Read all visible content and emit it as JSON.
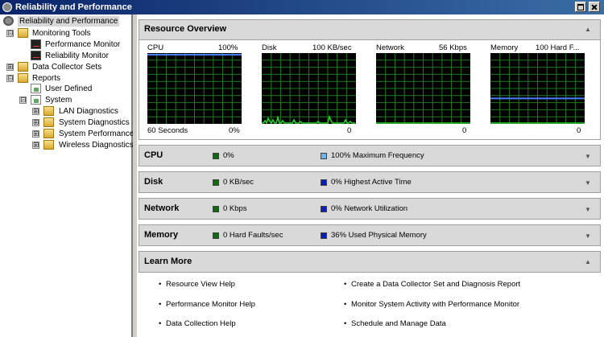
{
  "window": {
    "title": "Reliability and Performance"
  },
  "tree": {
    "items": [
      {
        "label": "Reliability and Performance",
        "icon": "gear-icon"
      },
      {
        "label": "Monitoring Tools",
        "expander": "⊟",
        "icon": "folder-icon"
      },
      {
        "label": "Performance Monitor",
        "icon": "monitor-icon"
      },
      {
        "label": "Reliability Monitor",
        "icon": "monitor-icon"
      },
      {
        "label": "Data Collector Sets",
        "expander": "⊞",
        "icon": "folder-icon"
      },
      {
        "label": "Reports",
        "expander": "⊟",
        "icon": "folder-icon"
      },
      {
        "label": "User Defined",
        "icon": "report-icon"
      },
      {
        "label": "System",
        "expander": "⊟",
        "icon": "report-icon"
      },
      {
        "label": "LAN Diagnostics",
        "expander": "⊞",
        "icon": "folder-icon"
      },
      {
        "label": "System Diagnostics",
        "expander": "⊞",
        "icon": "folder-icon"
      },
      {
        "label": "System Performance",
        "expander": "⊞",
        "icon": "folder-icon"
      },
      {
        "label": "Wireless Diagnostics",
        "expander": "⊞",
        "icon": "folder-icon"
      }
    ]
  },
  "overview": {
    "title": "Resource Overview",
    "collapse_glyph": "▲",
    "graphs": [
      {
        "name": "CPU",
        "max": "100%",
        "bottom_left": "60 Seconds",
        "bottom_right": "0%"
      },
      {
        "name": "Disk",
        "max": "100 KB/sec",
        "bottom_left": "",
        "bottom_right": "0"
      },
      {
        "name": "Network",
        "max": "56 Kbps",
        "bottom_left": "",
        "bottom_right": "0"
      },
      {
        "name": "Memory",
        "max": "100 Hard F...",
        "bottom_left": "",
        "bottom_right": "0"
      }
    ]
  },
  "sections": [
    {
      "title": "CPU",
      "left_text": "0%",
      "right_text": "100% Maximum Frequency",
      "left_color": "#0f6b0f",
      "right_color": "#6fb6e8"
    },
    {
      "title": "Disk",
      "left_text": "0 KB/sec",
      "right_text": "0% Highest Active Time",
      "left_color": "#0f6b0f",
      "right_color": "#0a1fb5"
    },
    {
      "title": "Network",
      "left_text": "0 Kbps",
      "right_text": "0% Network Utilization",
      "left_color": "#0f6b0f",
      "right_color": "#0a1fb5"
    },
    {
      "title": "Memory",
      "left_text": "0 Hard Faults/sec",
      "right_text": "36% Used Physical Memory",
      "left_color": "#0f6b0f",
      "right_color": "#0a1fb5"
    }
  ],
  "expand_glyph": "▼",
  "learn_more": {
    "title": "Learn More",
    "collapse_glyph": "▲",
    "links": [
      "Resource View Help",
      "Performance Monitor Help",
      "Data Collection Help",
      "Create a Data Collector Set and Diagnosis Report",
      "Monitor System Activity with Performance Monitor",
      "Schedule and Manage Data"
    ]
  },
  "colors": {
    "grid": "#1f7a1f",
    "series_blue": "#4a7cff",
    "series_green": "#2bd62b"
  },
  "memory_graph_level_percent": 36
}
